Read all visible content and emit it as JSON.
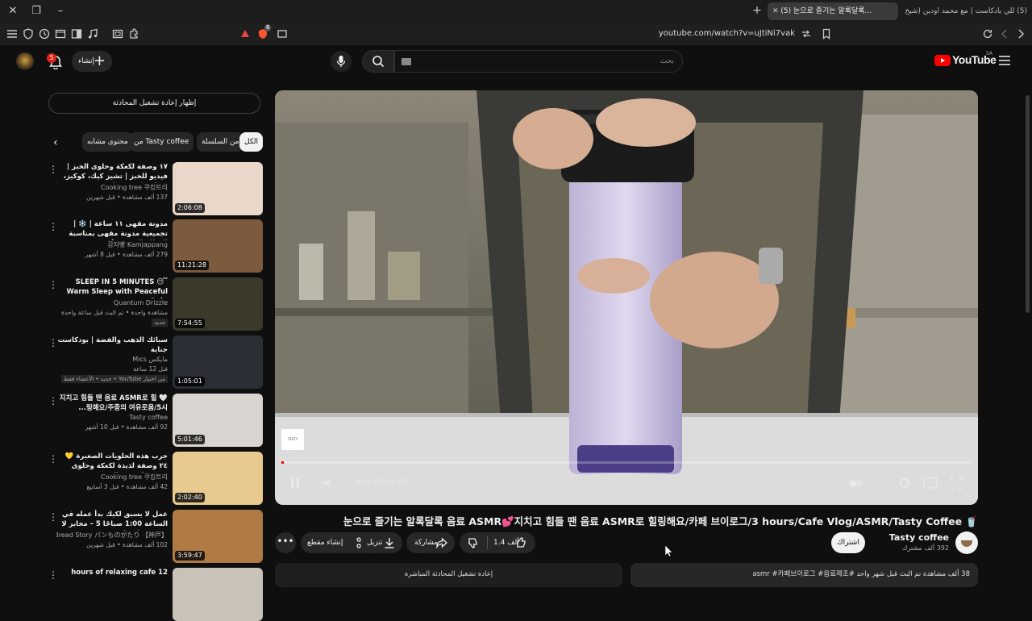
{
  "browser": {
    "tabs": [
      {
        "label": "(5) 눈으로 즐기는 알록달록...",
        "active": true
      },
      {
        "label": "(5) للي بادكاست | مع محمد اودين (شيخ",
        "active": false
      }
    ],
    "url": "youtube.com/watch?v=uJtiNi7vak",
    "shield_badge": "6"
  },
  "header": {
    "notifications_count": "5",
    "create_label": "إنشاء",
    "search_placeholder": "بحث",
    "logo_text": "YouTube",
    "country_code": "SA"
  },
  "sidebar": {
    "live_chat_button": "إظهار إعادة تشغيل المحادثة",
    "chips": [
      {
        "label": "الكل",
        "selected": true
      },
      {
        "label": "من السلسلة",
        "selected": false
      },
      {
        "label": "من Tasty coffee",
        "selected": false
      },
      {
        "label": "محتوى مشابه",
        "selected": false
      }
    ],
    "recommendations": [
      {
        "title": "١٧ وصفة لكعكة وحلوى الخبز | فيديو للخبز | تشيز كيك، كوكيز، دونات، كريب، مافن",
        "channel": "Cooking tree 쿠킹트리",
        "meta": "137 ألف مشاهدة • قبل شهرين",
        "duration": "2:06:08",
        "badge": "",
        "thumb": "#e9d8c9"
      },
      {
        "title": "مدونة مقهى ١١ ساعة | ❄️ | تجميعية مدونة مقهى بمناسبة العطلة الذهبية ❄️",
        "channel": "감자빵 Kamjappang",
        "meta": "279 ألف مشاهدة • قبل 8 أشهر",
        "duration": "11:21:28",
        "badge": "",
        "thumb": "#7b5a3e"
      },
      {
        "title": "SLEEP IN 5 MINUTES 😴 Warm Sleep with Peaceful Rain...",
        "channel": "Quantum Drizzle",
        "meta": "مشاهدة واحدة • تم البث قبل ساعة واحدة",
        "duration": "7:54:55",
        "badge": "جديد",
        "thumb": "#3b3a2a"
      },
      {
        "title": "سبائك الذهب والفضة | بودكاست جناية",
        "channel": "مايكس Mics",
        "meta": "قبل 12 ساعة",
        "duration": "1:05:01",
        "badge": "من اختيار YouTube • جديد • الأعضاء فقط",
        "thumb": "#2b2f35"
      },
      {
        "title": "🤍 지치고 힘들 땐 음료 ASMR로 힐링해요/주중의 여유로움/5시...",
        "channel": "Tasty coffee",
        "meta": "92 ألف مشاهدة • قبل 10 أشهر",
        "duration": "5:01:46",
        "badge": "",
        "thumb": "#d9d4cf"
      },
      {
        "title": "جرب هذه الحلويات الصغيرة 💛 ٢٤ وصفة لذيذة لكعكة وحلوى صغيرة | فيديو الخبز",
        "channel": "Cooking tree 쿠킹트리",
        "meta": "42 ألف مشاهدة • قبل 3 أسابيع",
        "duration": "2:02:40",
        "badge": "",
        "thumb": "#e8c98f"
      },
      {
        "title": "عمل لا يسبق لكيك بدأ عمله في الساعة 1:00 صباحًا 5 – مخابز لا بد من زيارتها...",
        "channel": "Bread Story パンものがたり 【神戸】",
        "meta": "102 ألف مشاهدة • قبل شهرين",
        "duration": "3:59:47",
        "badge": "",
        "thumb": "#b07a45"
      },
      {
        "title": "12 hours of relaxing cafe",
        "channel": "",
        "meta": "",
        "duration": "",
        "badge": "",
        "thumb": "#c8c2b8"
      }
    ]
  },
  "player": {
    "time": "0:11 / 3:46:43",
    "progress": 0.003
  },
  "video": {
    "title": "🥤 눈으로 즐기는 알록달록 음료 ASMR💕지치고 힘들 땐 음료 ASMR로 힐링해요/카페 브이로그/3 hours/Cafe Vlog/ASMR/Tasty Coffee",
    "channel_name": "Tasty coffee",
    "subscribers": "392 ألف مشترك",
    "subscribe_label": "اشتراك",
    "likes": "1.4 ألف",
    "share_label": "مشاركة",
    "download_label": "تنزيل",
    "clip_label": "إنشاء مقطع",
    "description_preview": "38 ألف مشاهدة  تم البث قبل شهر واحد  #asmr #카페브이로그 #음료제조",
    "replay_chat_label": "إعادة تشغيل المحادثة المباشرة"
  }
}
